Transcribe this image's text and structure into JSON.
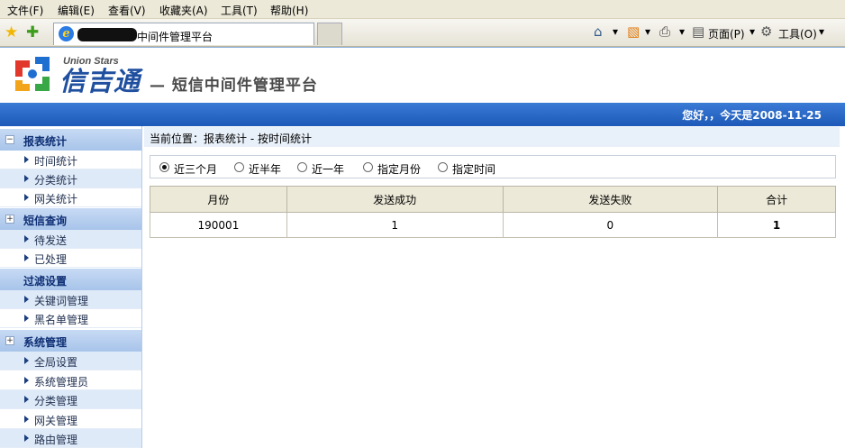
{
  "browser": {
    "menu": [
      "文件(F)",
      "编辑(E)",
      "查看(V)",
      "收藏夹(A)",
      "工具(T)",
      "帮助(H)"
    ],
    "tab_title": "中间件管理平台",
    "toolbar": {
      "page_label": "页面(P)",
      "tools_label": "工具(O)"
    }
  },
  "header": {
    "logo_en": "Union Stars",
    "logo_cn": "信吉通",
    "title": "— 短信中间件管理平台",
    "greeting": "您好，，今天是2008-11-25"
  },
  "sidebar": {
    "groups": [
      {
        "label": "报表统计",
        "toggle": "−",
        "items": [
          "时间统计",
          "分类统计",
          "网关统计"
        ]
      },
      {
        "label": "短信查询",
        "toggle": "+",
        "items": [
          "待发送",
          "已处理"
        ]
      },
      {
        "label": "过滤设置",
        "toggle": "",
        "items": [
          "关键词管理",
          "黑名单管理"
        ]
      },
      {
        "label": "系统管理",
        "toggle": "+",
        "items": [
          "全局设置",
          "系统管理员",
          "分类管理",
          "网关管理",
          "路由管理"
        ]
      }
    ]
  },
  "breadcrumb": "当前位置：报表统计 - 按时间统计",
  "filters": {
    "options": [
      "近三个月",
      "近半年",
      "近一年",
      "指定月份",
      "指定时间"
    ],
    "selected": "近三个月"
  },
  "table": {
    "headers": [
      "月份",
      "发送成功",
      "发送失败",
      "合计"
    ],
    "rows": [
      [
        "190001",
        "1",
        "0",
        "1"
      ]
    ]
  },
  "colors": {
    "accent_bar": "#1d59b8",
    "sidebar_group": "#a7c4ea",
    "table_header": "#ece9d8"
  }
}
